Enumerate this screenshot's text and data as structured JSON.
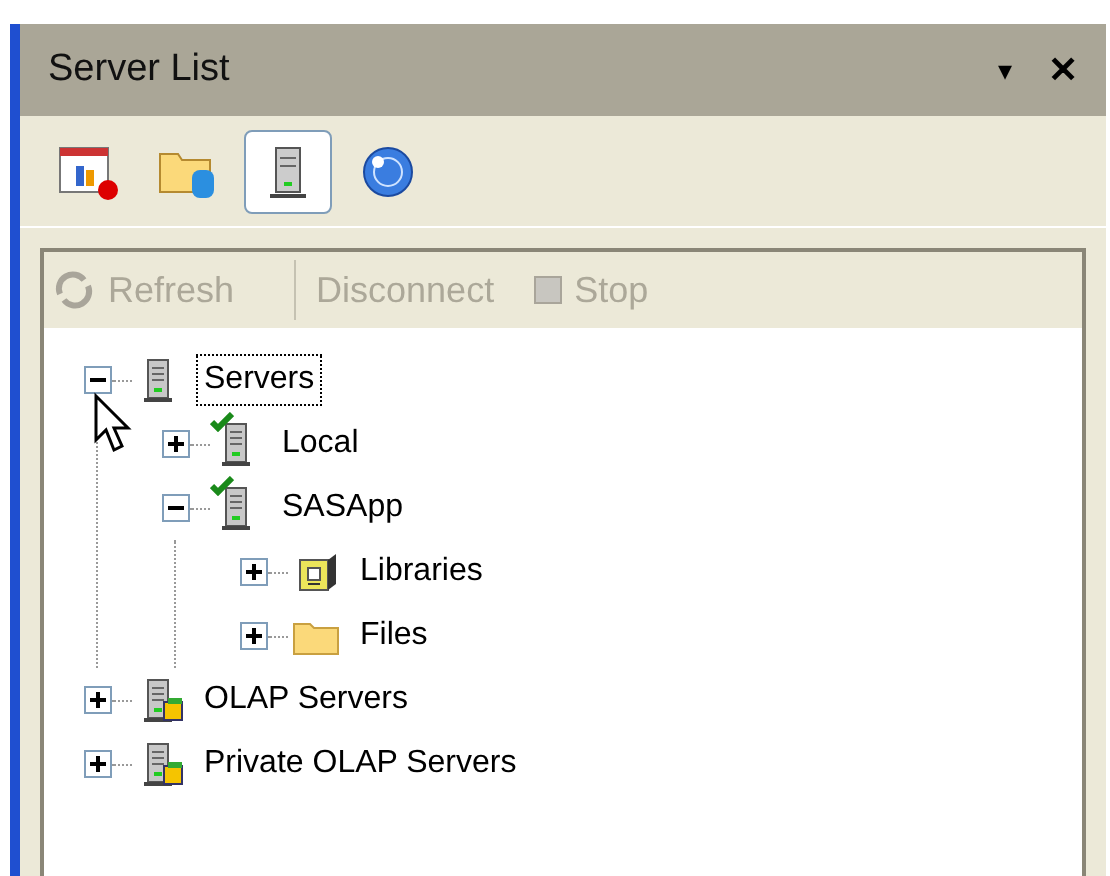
{
  "window": {
    "title": "Server List",
    "menu_glyph": "▾",
    "close_glyph": "✕"
  },
  "view_buttons": [
    {
      "kind": "report",
      "selected": false
    },
    {
      "kind": "folder-db",
      "selected": false
    },
    {
      "kind": "server",
      "selected": true
    },
    {
      "kind": "globe",
      "selected": false
    }
  ],
  "commands": [
    {
      "label": "Refresh",
      "kind": "refresh",
      "disabled": true
    },
    {
      "label": "Disconnect",
      "kind": "plain",
      "disabled": true
    },
    {
      "label": "Stop",
      "kind": "stop",
      "disabled": true
    }
  ],
  "tree": [
    {
      "label": "Servers",
      "kind": "server",
      "expanded": true,
      "selected": true,
      "connected": false,
      "children": [
        {
          "label": "Local",
          "kind": "server",
          "expanded": false,
          "selected": false,
          "connected": true
        },
        {
          "label": "SASApp",
          "kind": "server",
          "expanded": true,
          "selected": false,
          "connected": true,
          "children": [
            {
              "label": "Libraries",
              "kind": "library",
              "expanded": false,
              "selected": false,
              "connected": false
            },
            {
              "label": "Files",
              "kind": "folder",
              "expanded": false,
              "selected": false,
              "connected": false
            }
          ]
        }
      ]
    },
    {
      "label": "OLAP Servers",
      "kind": "olap",
      "expanded": false,
      "selected": false,
      "connected": false
    },
    {
      "label": "Private OLAP Servers",
      "kind": "olap",
      "expanded": false,
      "selected": false,
      "connected": false
    }
  ]
}
